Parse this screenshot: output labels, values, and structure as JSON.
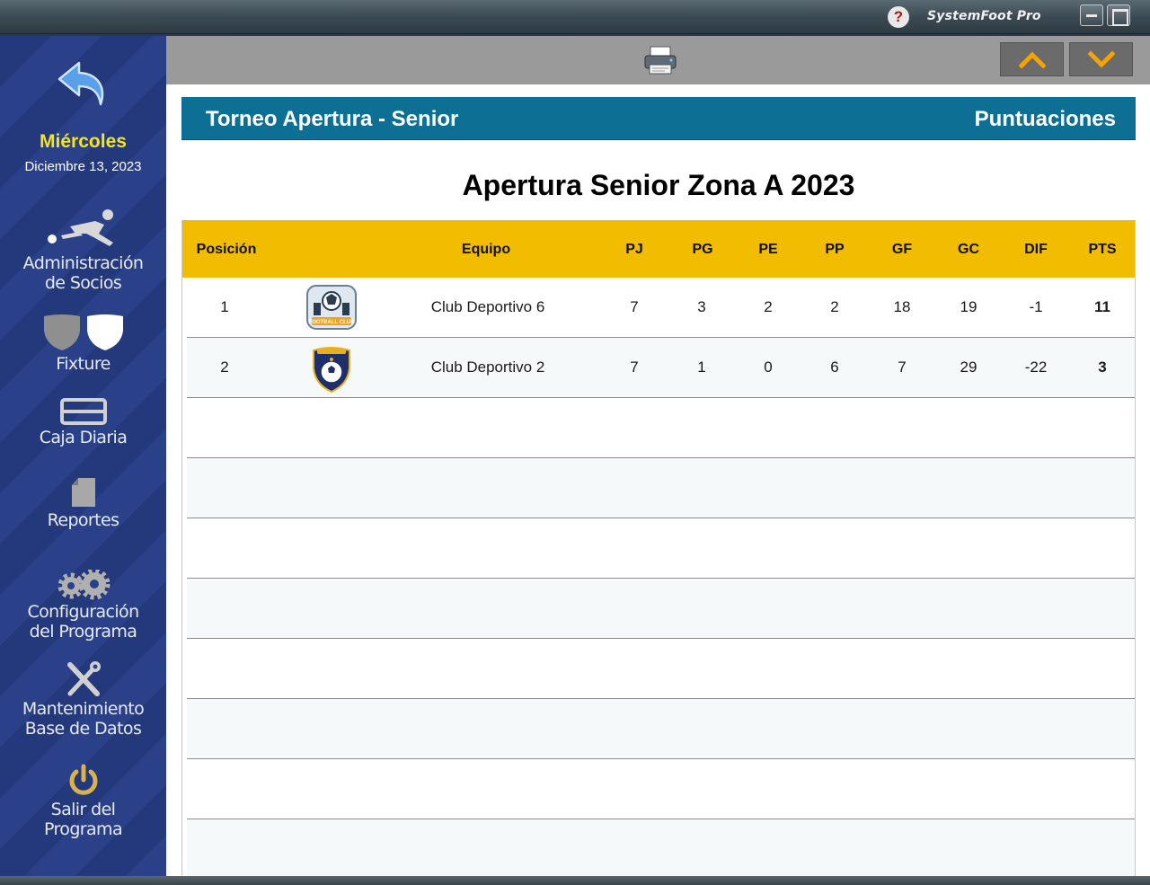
{
  "window": {
    "app_title": "SystemFoot Pro",
    "help_label": "?"
  },
  "sidebar": {
    "day": "Miércoles",
    "date": "Diciembre 13, 2023",
    "items": [
      {
        "line1": "Administración",
        "line2": "de Socios",
        "icon": "soccer-player-icon"
      },
      {
        "line1": "Fixture",
        "line2": "",
        "icon": "shields-icon"
      },
      {
        "line1": "Caja Diaria",
        "line2": "",
        "icon": "cash-register-icon"
      },
      {
        "line1": "Reportes",
        "line2": "",
        "icon": "document-icon"
      },
      {
        "line1": "Configuración",
        "line2": "del Programa",
        "icon": "gears-icon"
      },
      {
        "line1": "Mantenimiento",
        "line2": "Base de Datos",
        "icon": "tools-icon"
      },
      {
        "line1": "Salir del",
        "line2": "Programa",
        "icon": "power-icon"
      }
    ]
  },
  "colors": {
    "banner": "#0e6f95",
    "table_header": "#f2bd00",
    "sidebar": "#24397c",
    "accent_yellow": "#f5e51c",
    "arrow_orange": "#f4a300"
  },
  "banner": {
    "left": "Torneo Apertura - Senior",
    "right": "Puntuaciones"
  },
  "zone_title": "Apertura Senior Zona A 2023",
  "table": {
    "headers": [
      "Posición",
      "Equipo",
      "PJ",
      "PG",
      "PE",
      "PP",
      "GF",
      "GC",
      "DIF",
      "PTS"
    ],
    "rows": [
      {
        "pos": "1",
        "team": "Club Deportivo 6",
        "pj": "7",
        "pg": "3",
        "pe": "2",
        "pp": "2",
        "gf": "18",
        "gc": "19",
        "dif": "-1",
        "pts": "11",
        "logo": "football-club-badge-icon",
        "logo_text": "FOOTBALL CLUB"
      },
      {
        "pos": "2",
        "team": "Club Deportivo 2",
        "pj": "7",
        "pg": "1",
        "pe": "0",
        "pp": "6",
        "gf": "7",
        "gc": "29",
        "dif": "-22",
        "pts": "3",
        "logo": "shield-ball-badge-icon",
        "logo_text": ""
      }
    ]
  }
}
